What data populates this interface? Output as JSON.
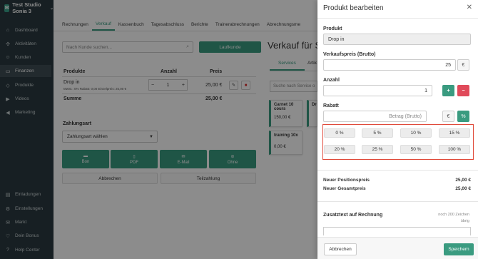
{
  "studio": {
    "name": "Test Studio Sonia 3"
  },
  "sidebar": {
    "items": [
      {
        "label": "Dashboard",
        "icon": "home-icon"
      },
      {
        "label": "Aktivitäten",
        "icon": "activity-icon"
      },
      {
        "label": "Kunden",
        "icon": "user-icon"
      },
      {
        "label": "Finanzen",
        "icon": "finance-icon"
      },
      {
        "label": "Produkte",
        "icon": "tag-icon"
      },
      {
        "label": "Videos",
        "icon": "play-icon"
      },
      {
        "label": "Marketing",
        "icon": "megaphone-icon"
      },
      {
        "label": "Einladungen",
        "icon": "invite-icon"
      },
      {
        "label": "Einstellungen",
        "icon": "gear-icon"
      },
      {
        "label": "Markt",
        "icon": "market-icon"
      },
      {
        "label": "Dein Bonus",
        "icon": "heart-icon"
      },
      {
        "label": "Help Center",
        "icon": "help-icon"
      }
    ]
  },
  "topnav": {
    "tabs": [
      {
        "label": "Rechnungen"
      },
      {
        "label": "Verkauf"
      },
      {
        "label": "Kassenbuch"
      },
      {
        "label": "Tagesabschluss"
      },
      {
        "label": "Berichte"
      },
      {
        "label": "Trainerabrechnungen"
      },
      {
        "label": "Abrechnungsme"
      }
    ]
  },
  "sale": {
    "search_placeholder": "Nach Kunde suchen...",
    "walkin_label": "Laufkunde",
    "heading": "Verkauf für S",
    "col_products": "Produkte",
    "col_qty": "Anzahl",
    "col_price": "Preis",
    "item": {
      "name": "Drop in",
      "meta": "MwSt.: 0% Rabatt: 0,00 Einzelpreis: 25,00 €",
      "qty": "1",
      "price": "25,00 €"
    },
    "sum_label": "Summe",
    "sum_value": "25,00 €",
    "payment_label": "Zahlungsart",
    "payment_select": "Zahlungsart wählen",
    "pay_buttons": [
      {
        "label": "Bon",
        "icon": "printer-icon"
      },
      {
        "label": "PDF",
        "icon": "pdf-icon"
      },
      {
        "label": "E-Mail",
        "icon": "mail-icon"
      },
      {
        "label": "Ohne",
        "icon": "ban-icon"
      }
    ],
    "cancel_label": "Abbrechen",
    "partial_label": "Teilzahlung"
  },
  "catalog": {
    "tabs": [
      "Services",
      "Artik"
    ],
    "search_placeholder": "Suche nach Service o",
    "cards": [
      {
        "name": "Carnet 10 cours",
        "price": "150,00 €"
      },
      {
        "name": "Dro",
        "price": ""
      },
      {
        "name": "training 10x",
        "price": "0,00 €"
      }
    ]
  },
  "modal": {
    "title": "Produkt bearbeiten",
    "product_label": "Produkt",
    "product_value": "Drop in",
    "price_label": "Verkaufspreis (Brutto)",
    "price_value": "25",
    "currency": "€",
    "qty_label": "Anzahl",
    "qty_value": "1",
    "plus": "+",
    "minus": "−",
    "discount_label": "Rabatt",
    "discount_placeholder": "Betrag (Brutto)",
    "discount_euro": "€",
    "discount_percent": "%",
    "discounts": [
      "0 %",
      "5 %",
      "10 %",
      "15 %",
      "20 %",
      "25 %",
      "50 %",
      "100 %"
    ],
    "new_position_label": "Neuer Positionspreis",
    "new_position_value": "25,00 €",
    "new_total_label": "Neuer Gesamtpreis",
    "new_total_value": "25,00 €",
    "note_label": "Zusatztext auf Rechnung",
    "note_hint_line1": "noch 200 Zeichen",
    "note_hint_line2": "übrig",
    "cancel_label": "Abbrechen",
    "save_label": "Speichern"
  },
  "colors": {
    "accent": "#3a9b80",
    "danger": "#e04a5a",
    "highlight": "#e04a3a",
    "sidebar": "#2b3a40"
  }
}
